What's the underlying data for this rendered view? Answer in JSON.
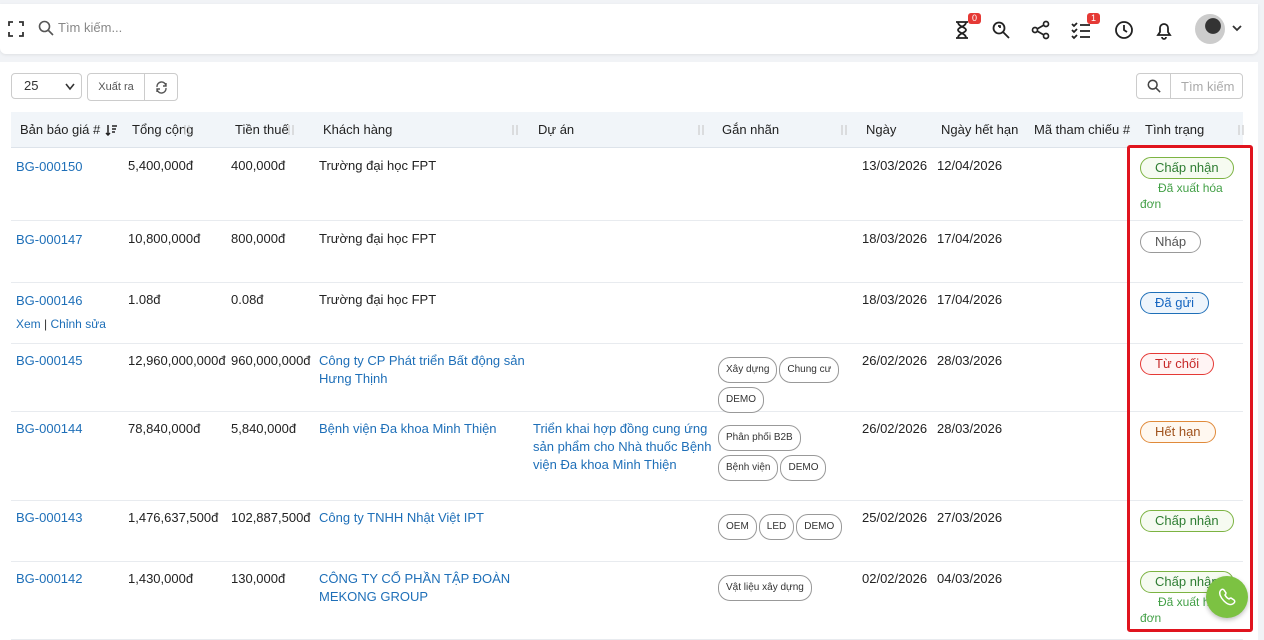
{
  "topbar": {
    "search_placeholder": "Tìm kiếm...",
    "badges": {
      "timer": "0",
      "tasks": "1"
    }
  },
  "toolbar": {
    "page_length": "25",
    "export_label": "Xuất ra",
    "search_placeholder": "Tìm kiếm"
  },
  "columns": [
    "Bản báo giá #",
    "Tổng cộng",
    "Tiền thuế",
    "Khách hàng",
    "Dự án",
    "Gắn nhãn",
    "Ngày",
    "Ngày hết hạn",
    "Mã tham chiếu #",
    "Tình trạng"
  ],
  "row_actions": {
    "view": "Xem",
    "sep": "|",
    "edit": "Chỉnh sửa"
  },
  "rows": [
    {
      "id": "BG-000150",
      "total": "5,400,000đ",
      "tax": "400,000đ",
      "customer": "Trường đại học FPT",
      "project": "",
      "tags": [],
      "date": "13/03/2026",
      "expiry": "12/04/2026",
      "ref": "",
      "status": "Chấp nhận",
      "note": "Đã xuất hóa đơn"
    },
    {
      "id": "BG-000147",
      "total": "10,800,000đ",
      "tax": "800,000đ",
      "customer": "Trường đại học FPT",
      "project": "",
      "tags": [],
      "date": "18/03/2026",
      "expiry": "17/04/2026",
      "ref": "",
      "status": "Nháp",
      "note": ""
    },
    {
      "id": "BG-000146",
      "total": "1.08đ",
      "tax": "0.08đ",
      "customer": "Trường đại học FPT",
      "project": "",
      "tags": [],
      "date": "18/03/2026",
      "expiry": "17/04/2026",
      "ref": "",
      "status": "Đã gửi",
      "note": ""
    },
    {
      "id": "BG-000145",
      "total": "12,960,000,000đ",
      "tax": "960,000,000đ",
      "customer": "Công ty CP Phát triển Bất động sản Hưng Thịnh",
      "project": "",
      "tags": [
        "Xây dựng",
        "Chung cư",
        "DEMO"
      ],
      "date": "26/02/2026",
      "expiry": "28/03/2026",
      "ref": "",
      "status": "Từ chối",
      "note": ""
    },
    {
      "id": "BG-000144",
      "total": "78,840,000đ",
      "tax": "5,840,000đ",
      "customer": "Bệnh viện Đa khoa Minh Thiện",
      "project": "Triển khai hợp đồng cung ứng sản phẩm cho Nhà thuốc Bệnh viện Đa khoa Minh Thiện",
      "tags": [
        "Phân phối B2B",
        "Bệnh viện",
        "DEMO"
      ],
      "date": "26/02/2026",
      "expiry": "28/03/2026",
      "ref": "",
      "status": "Hết hạn",
      "note": ""
    },
    {
      "id": "BG-000143",
      "total": "1,476,637,500đ",
      "tax": "102,887,500đ",
      "customer": "Công ty TNHH Nhật Việt IPT",
      "project": "",
      "tags": [
        "OEM",
        "LED",
        "DEMO"
      ],
      "date": "25/02/2026",
      "expiry": "27/03/2026",
      "ref": "",
      "status": "Chấp nhận",
      "note": ""
    },
    {
      "id": "BG-000142",
      "total": "1,430,000đ",
      "tax": "130,000đ",
      "customer": "CÔNG TY CỔ PHẦN TẬP ĐOÀN MEKONG GROUP",
      "project": "",
      "tags": [
        "Vật liệu xây dựng"
      ],
      "date": "02/02/2026",
      "expiry": "04/03/2026",
      "ref": "",
      "status": "Chấp nhận",
      "note": "Đã xuất hóa đơn"
    }
  ]
}
